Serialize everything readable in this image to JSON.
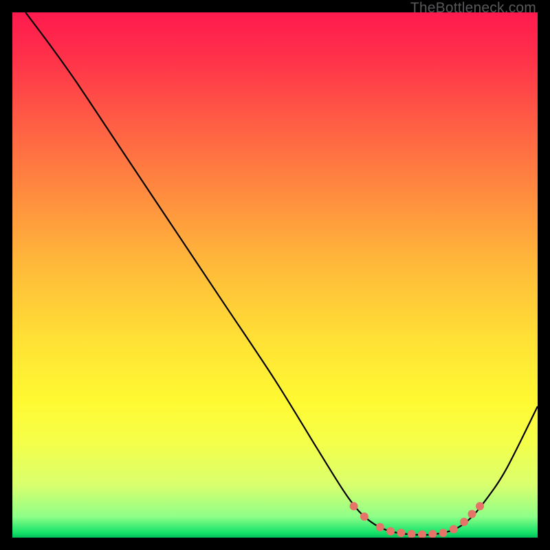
{
  "watermark": "TheBottleneck.com",
  "chart_data": {
    "type": "line",
    "title": "",
    "xlabel": "",
    "ylabel": "",
    "xlim": [
      0,
      100
    ],
    "ylim": [
      0,
      100
    ],
    "series": [
      {
        "name": "bottleneck-curve",
        "points": [
          {
            "x": 2.5,
            "y": 100
          },
          {
            "x": 7,
            "y": 94
          },
          {
            "x": 12,
            "y": 87
          },
          {
            "x": 20,
            "y": 75
          },
          {
            "x": 30,
            "y": 60
          },
          {
            "x": 40,
            "y": 45
          },
          {
            "x": 50,
            "y": 30
          },
          {
            "x": 58,
            "y": 17
          },
          {
            "x": 63,
            "y": 9
          },
          {
            "x": 66,
            "y": 5
          },
          {
            "x": 69,
            "y": 2.5
          },
          {
            "x": 72,
            "y": 1.2
          },
          {
            "x": 76,
            "y": 0.6
          },
          {
            "x": 80,
            "y": 0.6
          },
          {
            "x": 84,
            "y": 1.5
          },
          {
            "x": 87,
            "y": 3.5
          },
          {
            "x": 90,
            "y": 7
          },
          {
            "x": 94,
            "y": 13
          },
          {
            "x": 100,
            "y": 25
          }
        ]
      }
    ],
    "highlight_dots": [
      {
        "x": 65,
        "y": 6
      },
      {
        "x": 67,
        "y": 4
      },
      {
        "x": 70,
        "y": 2
      },
      {
        "x": 72,
        "y": 1.2
      },
      {
        "x": 74,
        "y": 0.9
      },
      {
        "x": 76,
        "y": 0.7
      },
      {
        "x": 78,
        "y": 0.6
      },
      {
        "x": 80,
        "y": 0.7
      },
      {
        "x": 82,
        "y": 0.9
      },
      {
        "x": 84,
        "y": 1.6
      },
      {
        "x": 86,
        "y": 3
      },
      {
        "x": 87.5,
        "y": 4.5
      },
      {
        "x": 89,
        "y": 6
      }
    ]
  }
}
